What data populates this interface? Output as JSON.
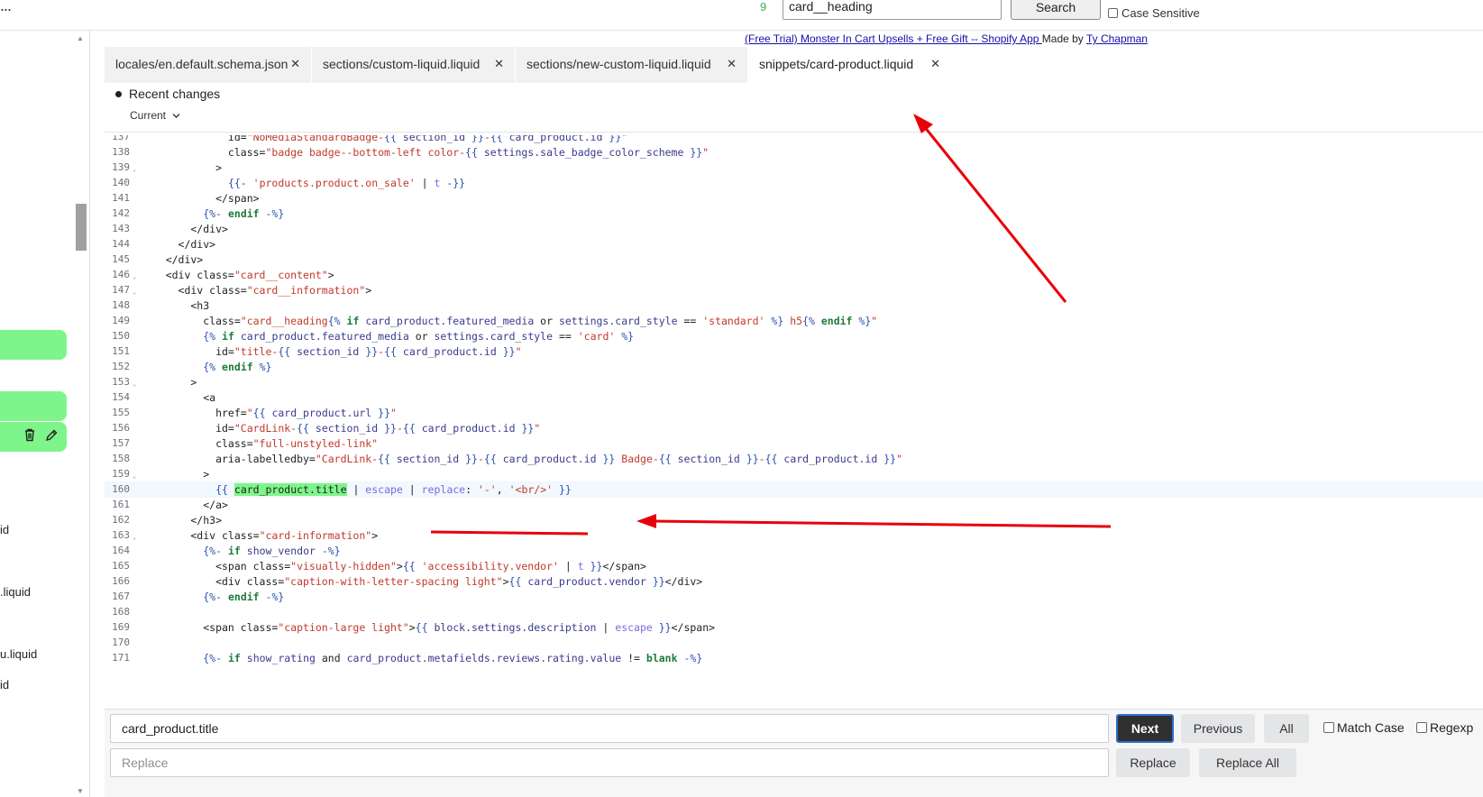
{
  "topbar": {
    "menu_dots": "...",
    "result_count": "9",
    "search_value": "card__heading",
    "search_button": "Search",
    "case_sensitive_label": "Case Sensitive",
    "promo_link": "(Free Trial) Monster In Cart Upsells + Free Gift -- Shopify App ",
    "promo_madeby": "Made by ",
    "promo_author": "Ty Chapman"
  },
  "sidebar": {
    "file_fragments": [
      "id",
      ".liquid",
      "u.liquid",
      "id"
    ]
  },
  "tabs": [
    {
      "label": "locales/en.default.schema.json"
    },
    {
      "label": "sections/custom-liquid.liquid"
    },
    {
      "label": "sections/new-custom-liquid.liquid"
    },
    {
      "label": "snippets/card-product.liquid"
    }
  ],
  "recent_changes": {
    "label": "Recent changes",
    "version": "Current"
  },
  "editor": {
    "line_numbers": [
      "137",
      "138",
      "139",
      "140",
      "141",
      "142",
      "143",
      "144",
      "145",
      "146",
      "147",
      "148",
      "149",
      "150",
      "151",
      "152",
      "153",
      "154",
      "155",
      "156",
      "157",
      "158",
      "159",
      "160",
      "161",
      "162",
      "163",
      "164",
      "165",
      "166",
      "167",
      "168",
      "169",
      "170",
      "171"
    ],
    "highlighted_line": "160",
    "match_text": "card_product.title"
  },
  "find_replace": {
    "find_value": "card_product.title",
    "replace_placeholder": "Replace",
    "next": "Next",
    "previous": "Previous",
    "all": "All",
    "match_case": "Match Case",
    "regexp": "Regexp",
    "replace": "Replace",
    "replace_all": "Replace All"
  },
  "colors": {
    "accent_green": "#7ef58a",
    "annotation_red": "#e8000b",
    "primary_button": "#303030"
  },
  "annotations": [
    "red-arrow-to-tab",
    "red-arrow-to-line-160",
    "red-underline"
  ]
}
